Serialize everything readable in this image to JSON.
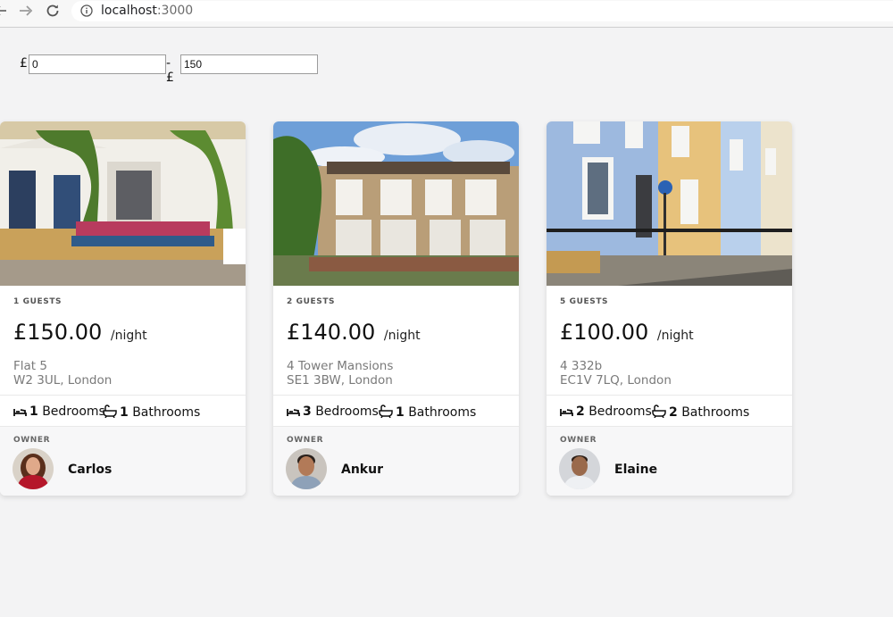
{
  "browser": {
    "back_icon": "arrow-left-icon",
    "forward_icon": "arrow-right-icon",
    "reload_icon": "reload-icon",
    "url_host": "localhost",
    "url_port": ":3000"
  },
  "filter": {
    "currency": "£",
    "separator": "-£",
    "min_value": "0",
    "max_value": "150"
  },
  "colors": {
    "page_bg": "#f3f3f4",
    "card_bg": "#ffffff",
    "owner_bg": "#f7f7f8",
    "muted_text": "#7a7a7a"
  },
  "listings": [
    {
      "guests": "1 GUESTS",
      "price": "£150.00",
      "per": "/night",
      "address_line1": "Flat 5",
      "address_line2": "W2 3UL, London",
      "bedrooms": "1",
      "bedrooms_label": "Bedrooms",
      "bathrooms": "1",
      "bathrooms_label": "Bathrooms",
      "owner_label": "OWNER",
      "owner_name": "Carlos"
    },
    {
      "guests": "2 GUESTS",
      "price": "£140.00",
      "per": "/night",
      "address_line1": "4 Tower Mansions",
      "address_line2": "SE1 3BW, London",
      "bedrooms": "3",
      "bedrooms_label": "Bedrooms",
      "bathrooms": "1",
      "bathrooms_label": "Bathrooms",
      "owner_label": "OWNER",
      "owner_name": "Ankur"
    },
    {
      "guests": "5 GUESTS",
      "price": "£100.00",
      "per": "/night",
      "address_line1": "4 332b",
      "address_line2": "EC1V 7LQ, London",
      "bedrooms": "2",
      "bedrooms_label": "Bedrooms",
      "bathrooms": "2",
      "bathrooms_label": "Bathrooms",
      "owner_label": "OWNER",
      "owner_name": "Elaine"
    }
  ]
}
